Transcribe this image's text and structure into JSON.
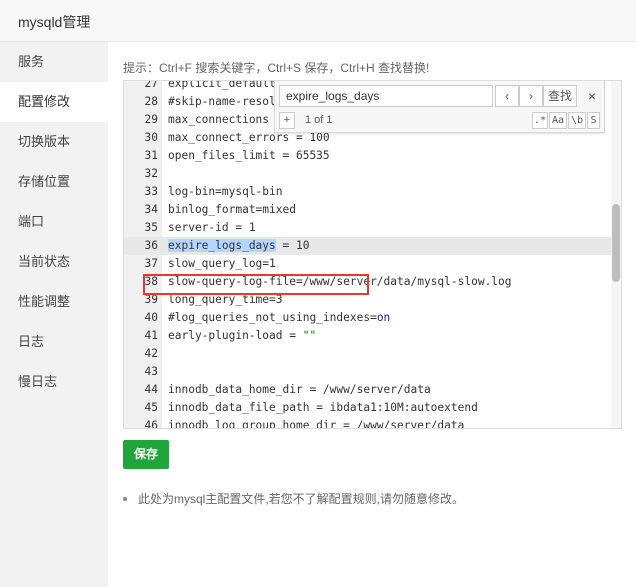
{
  "window": {
    "title": "mysqld管理"
  },
  "sidebar": {
    "items": [
      {
        "label": "服务",
        "active": false
      },
      {
        "label": "配置修改",
        "active": true
      },
      {
        "label": "切换版本",
        "active": false
      },
      {
        "label": "存储位置",
        "active": false
      },
      {
        "label": "端口",
        "active": false
      },
      {
        "label": "当前状态",
        "active": false
      },
      {
        "label": "性能调整",
        "active": false
      },
      {
        "label": "日志",
        "active": false
      },
      {
        "label": "慢日志",
        "active": false
      }
    ]
  },
  "main": {
    "hint": "提示：Ctrl+F 搜索关键字，Ctrl+S 保存，Ctrl+H 查找替换!",
    "save_label": "保存",
    "note": "此处为mysql主配置文件,若您不了解配置规则,请勿随意修改。"
  },
  "search": {
    "query": "expire_logs_days",
    "prev_icon": "‹",
    "next_icon": "›",
    "find_label": "查找",
    "close_icon": "×",
    "plus_icon": "+",
    "counter": "1 of 1",
    "opt_regex": ".*",
    "opt_case": "Aa",
    "opt_word": "\\b",
    "opt_selection": "S"
  },
  "editor": {
    "lines": [
      {
        "n": "27",
        "text": "explicit_default"
      },
      {
        "n": "28",
        "text": "#skip-name-resol"
      },
      {
        "n": "29",
        "text": "max_connections"
      },
      {
        "n": "30",
        "text": "max_connect_errors = 100"
      },
      {
        "n": "31",
        "text": "open_files_limit = 65535"
      },
      {
        "n": "32",
        "text": ""
      },
      {
        "n": "33",
        "text": "log-bin=mysql-bin"
      },
      {
        "n": "34",
        "text": "binlog_format=mixed"
      },
      {
        "n": "35",
        "text": "server-id = 1"
      },
      {
        "n": "36",
        "sel": "expire_logs_days",
        "rest": " = 10"
      },
      {
        "n": "37",
        "text": "slow_query_log=1"
      },
      {
        "n": "38",
        "text": "slow-query-log-file=/www/server/data/mysql-slow.log"
      },
      {
        "n": "39",
        "text": "long_query_time=3"
      },
      {
        "n": "40",
        "pre": "#log_queries_not_using_indexes=",
        "kw": "on"
      },
      {
        "n": "41",
        "pre": "early-plugin-load = ",
        "str": "\"\""
      },
      {
        "n": "42",
        "text": ""
      },
      {
        "n": "43",
        "text": ""
      },
      {
        "n": "44",
        "text": "innodb_data_home_dir = /www/server/data"
      },
      {
        "n": "45",
        "text": "innodb_data_file_path = ibdata1:10M:autoextend"
      },
      {
        "n": "46",
        "text": "innodb_log_group_home_dir = /www/server/data"
      }
    ]
  }
}
